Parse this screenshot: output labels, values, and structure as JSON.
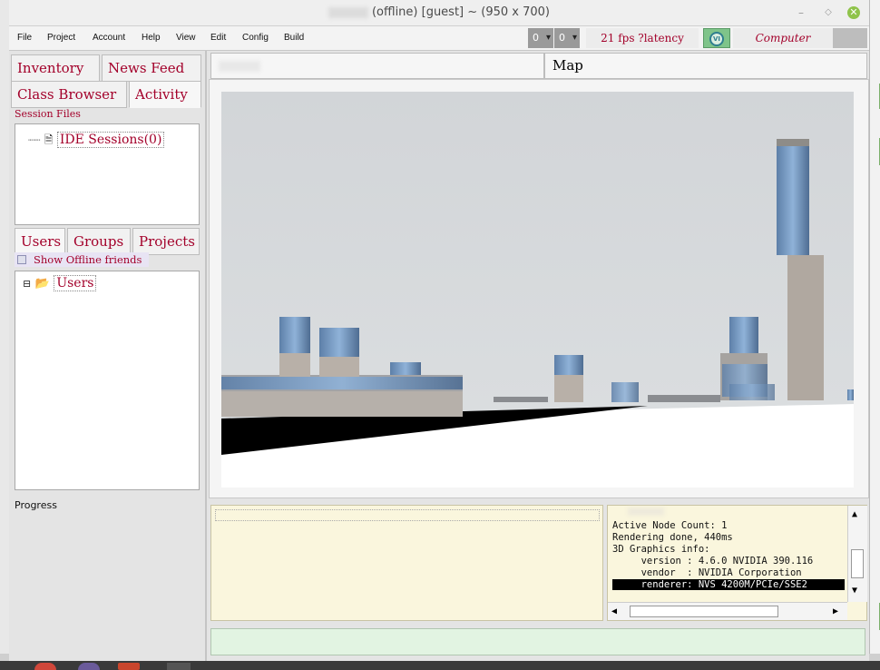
{
  "window": {
    "title": "(offline) [guest] ~ (950 x 700)",
    "controls": {
      "minimize": "–",
      "maximize": "◇",
      "close": "✕"
    }
  },
  "menubar": {
    "items": [
      "File",
      "Project",
      "Account",
      "Help",
      "View",
      "Edit",
      "Config",
      "Build"
    ],
    "counter1": "0",
    "counter2": "0",
    "fps": "21 fps  ?latency",
    "logo_text": "VI",
    "dept": "Computer Science"
  },
  "left": {
    "tabs_row1": [
      "Inventory",
      "News Feed"
    ],
    "tabs_row2": [
      "Class Browser",
      "Activity"
    ],
    "session_files_label": "Session Files",
    "session_tree": [
      "IDE Sessions(0)"
    ],
    "tabs_row3": [
      "Users",
      "Groups",
      "Projects"
    ],
    "show_offline": "Show Offline friends",
    "users_tree": [
      "Users"
    ],
    "progress_label": "Progress"
  },
  "main": {
    "tab_left": "",
    "tab_map": "Map"
  },
  "console": {
    "lines": [
      "Active Node Count: 1",
      "Rendering done, 440ms",
      "3D Graphics info:",
      "     version : 4.6.0 NVIDIA 390.116",
      "     vendor  : NVIDIA Corporation"
    ],
    "highlight_line": "     renderer: NVS 4200M/PCIe/SSE2"
  },
  "colors": {
    "accent": "#a3002a",
    "console_bg": "#faf6dd",
    "input_bg": "#e2f4e2"
  }
}
